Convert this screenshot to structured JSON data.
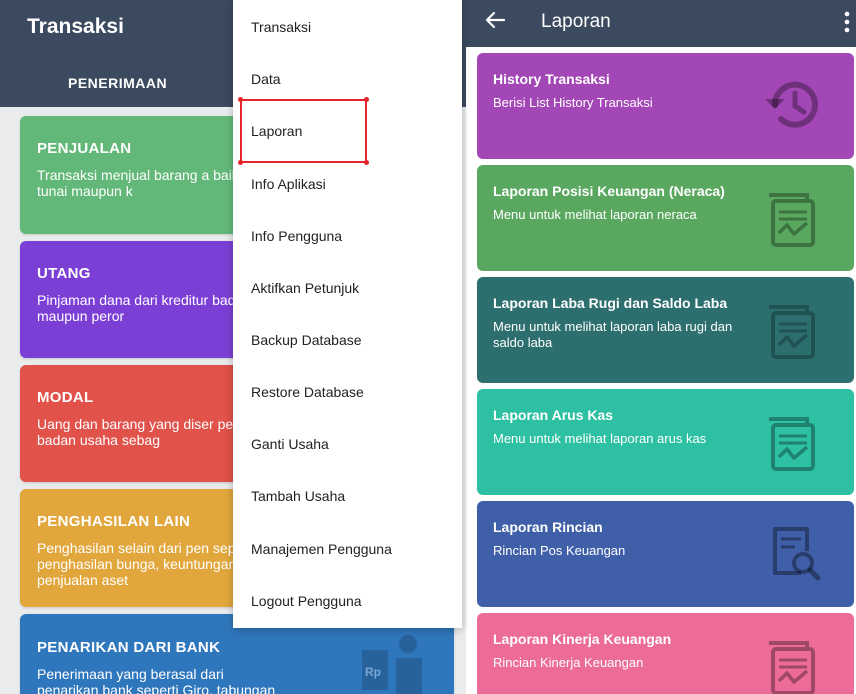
{
  "left": {
    "title": "Transaksi",
    "tab": "PENERIMAAN",
    "cards": [
      {
        "title": "PENJUALAN",
        "desc": "Transaksi menjual barang a baik secara tunai maupun k",
        "color": "#62b878"
      },
      {
        "title": "UTANG",
        "desc": "Pinjaman dana dari kreditur badan usaha maupun peror",
        "color": "#7c3fd6"
      },
      {
        "title": "MODAL",
        "desc": "Uang dan barang yang diser pemilik badan usaha sebag",
        "color": "#e0524a"
      },
      {
        "title": "PENGHASILAN LAIN",
        "desc": "Penghasilan selain dari pen seperti: penghasilan bunga, keuntungan penjualan aset",
        "color": "#e2a73c"
      },
      {
        "title": "PENARIKAN DARI BANK",
        "desc": "Penerimaan yang berasal dari penarikan bank seperti Giro, tabungan",
        "color": "#2f77bc"
      }
    ],
    "bank_icon_text": "Rp"
  },
  "menu": {
    "items": [
      "Transaksi",
      "Data",
      "Laporan",
      "Info Aplikasi",
      "Info Pengguna",
      "Aktifkan Petunjuk",
      "Backup Database",
      "Restore Database",
      "Ganti Usaha",
      "Tambah Usaha",
      "Manajemen Pengguna",
      "Logout Pengguna"
    ],
    "highlighted": "Laporan",
    "highlight_color": "#e5242b"
  },
  "right": {
    "title": "Laporan",
    "back_icon": "arrow-left-icon",
    "more_icon": "more-vertical-icon",
    "cards": [
      {
        "title": "History Transaksi",
        "desc": "Berisi List History Transaksi",
        "color": "#a447b6",
        "icon": "history-icon"
      },
      {
        "title": "Laporan Posisi Keuangan (Neraca)",
        "desc": "Menu untuk melihat laporan neraca",
        "color": "#5aa860",
        "icon": "report-chart-icon"
      },
      {
        "title": "Laporan Laba Rugi dan Saldo Laba",
        "desc": "Menu untuk melihat laporan laba rugi dan saldo laba",
        "color": "#2d6e6e",
        "icon": "report-chart-icon"
      },
      {
        "title": "Laporan Arus Kas",
        "desc": "Menu untuk melihat laporan arus kas",
        "color": "#2ec0a2",
        "icon": "report-chart-icon"
      },
      {
        "title": "Laporan Rincian",
        "desc": "Rincian Pos Keuangan",
        "color": "#3f5fa8",
        "icon": "document-search-icon"
      },
      {
        "title": "Laporan Kinerja Keuangan",
        "desc": "Rincian Kinerja Keuangan",
        "color": "#ec6b98",
        "icon": "report-chart-icon"
      }
    ]
  }
}
